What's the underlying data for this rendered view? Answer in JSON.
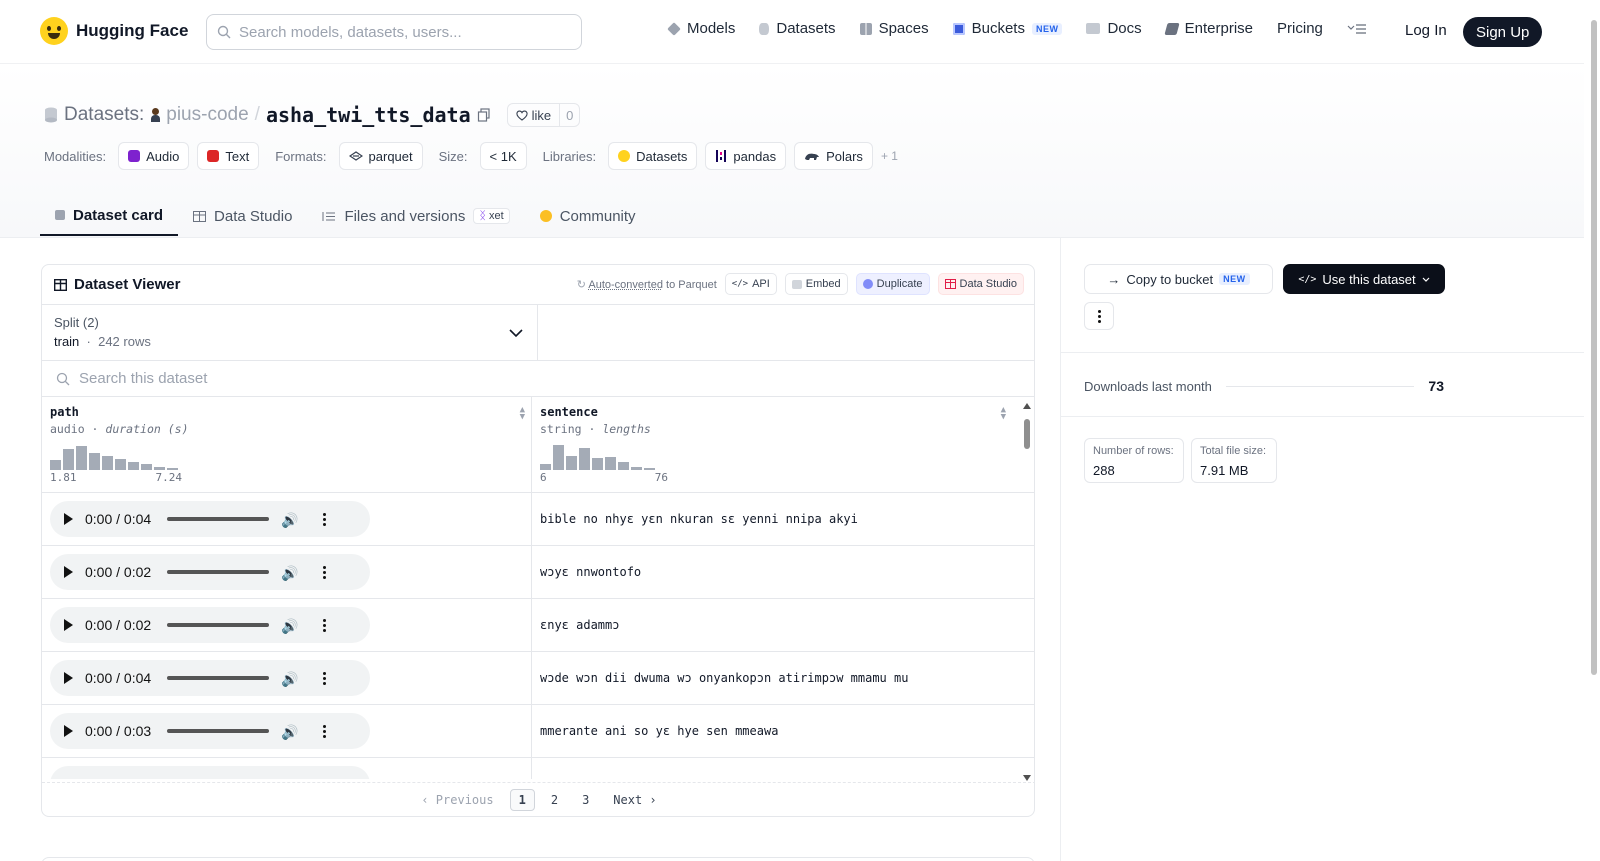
{
  "brand": {
    "name": "Hugging Face"
  },
  "search": {
    "placeholder": "Search models, datasets, users..."
  },
  "nav": {
    "models": "Models",
    "datasets": "Datasets",
    "spaces": "Spaces",
    "buckets": "Buckets",
    "buckets_badge": "NEW",
    "docs": "Docs",
    "enterprise": "Enterprise",
    "pricing": "Pricing",
    "login": "Log In",
    "signup": "Sign Up"
  },
  "repo": {
    "prefix": "Datasets:",
    "owner": "pius-code",
    "separator": "/",
    "name": "asha_twi_tts_data",
    "like_label": "like",
    "like_count": "0"
  },
  "meta": {
    "modalities_label": "Modalities:",
    "modalities": [
      "Audio",
      "Text"
    ],
    "formats_label": "Formats:",
    "format": "parquet",
    "size_label": "Size:",
    "size": "< 1K",
    "libraries_label": "Libraries:",
    "libraries": [
      "Datasets",
      "pandas",
      "Polars"
    ],
    "more": "+ 1"
  },
  "tabs": {
    "card": "Dataset card",
    "studio": "Data Studio",
    "files": "Files and versions",
    "xet": "xet",
    "community": "Community"
  },
  "viewer": {
    "title": "Dataset Viewer",
    "auto": "Auto-converted",
    "auto_suffix": "to Parquet",
    "api": "API",
    "embed": "Embed",
    "duplicate": "Duplicate",
    "studio": "Data Studio",
    "split_label": "Split (2)",
    "split_value": "train",
    "split_rows": "242 rows",
    "search_placeholder": "Search this dataset",
    "columns": [
      {
        "name": "path",
        "type": "audio",
        "stat": "duration (s)",
        "min": "1.81",
        "max": "7.24",
        "hist": [
          0.35,
          0.75,
          0.85,
          0.62,
          0.5,
          0.38,
          0.3,
          0.2,
          0.12,
          0.08
        ]
      },
      {
        "name": "sentence",
        "type": "string",
        "stat": "lengths",
        "min": "6",
        "max": "76",
        "hist": [
          0.22,
          0.9,
          0.5,
          0.8,
          0.42,
          0.45,
          0.3,
          0.1,
          0.05
        ]
      }
    ],
    "rows": [
      {
        "time": "0:00 / 0:04",
        "sentence": "bible no nhyɛ yɛn nkuran sɛ yenni nnipa akyi"
      },
      {
        "time": "0:00 / 0:02",
        "sentence": "wɔyɛ nnwontofo"
      },
      {
        "time": "0:00 / 0:02",
        "sentence": "ɛnyɛ adammɔ"
      },
      {
        "time": "0:00 / 0:04",
        "sentence": "wɔde wɔn dii dwuma wɔ onyankopɔn atirimpɔw mmamu mu"
      },
      {
        "time": "0:00 / 0:03",
        "sentence": "mmerante ani so yɛ hye sen mmeawa"
      }
    ],
    "pager": {
      "prev": "Previous",
      "pages": [
        "1",
        "2",
        "3"
      ],
      "next": "Next"
    }
  },
  "sidebar": {
    "copy": "Copy to bucket",
    "copy_badge": "NEW",
    "use": "Use this dataset",
    "downloads_label": "Downloads last month",
    "downloads": "73",
    "rows_label": "Number of rows:",
    "rows_value": "288",
    "filesize_label": "Total file size:",
    "filesize_value": "7.91 MB"
  }
}
